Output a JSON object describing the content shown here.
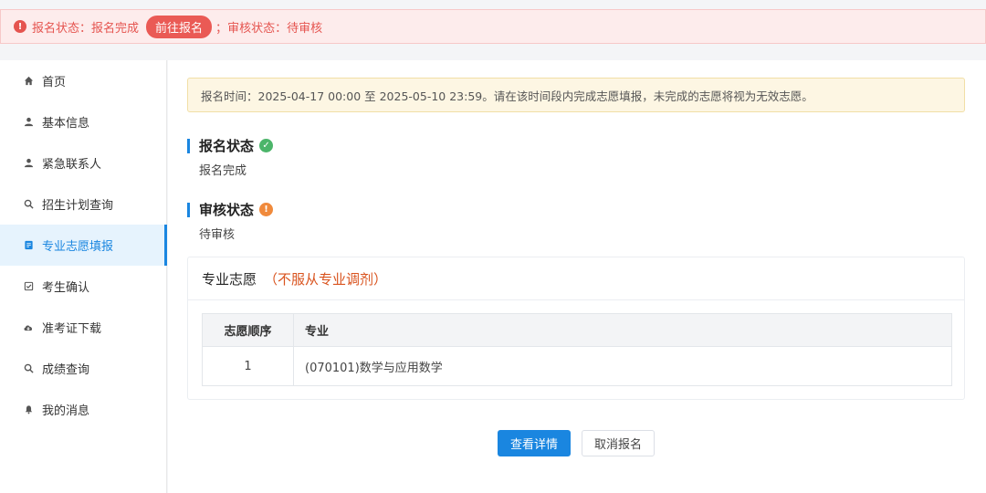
{
  "top_alert": {
    "status_label": "报名状态：",
    "status_value": "报名完成",
    "goto_button": "前往报名",
    "separator": "；",
    "review_label": "审核状态：",
    "review_value": "待审核",
    "icon": "error-icon",
    "color": "#e5544f"
  },
  "sidebar": {
    "active_color": "#1a86e0",
    "items": [
      {
        "label": "首页",
        "icon": "home-icon",
        "active": false
      },
      {
        "label": "基本信息",
        "icon": "user-icon",
        "active": false
      },
      {
        "label": "紧急联系人",
        "icon": "user-icon",
        "active": false
      },
      {
        "label": "招生计划查询",
        "icon": "search-icon",
        "active": false
      },
      {
        "label": "专业志愿填报",
        "icon": "document-icon",
        "active": true
      },
      {
        "label": "考生确认",
        "icon": "checkbox-icon",
        "active": false
      },
      {
        "label": "准考证下载",
        "icon": "cloud-download-icon",
        "active": false
      },
      {
        "label": "成绩查询",
        "icon": "search-icon",
        "active": false
      },
      {
        "label": "我的消息",
        "icon": "bell-icon",
        "active": false
      }
    ]
  },
  "notice": "报名时间：2025-04-17 00:00 至 2025-05-10 23:59。请在该时间段内完成志愿填报，未完成的志愿将视为无效志愿。",
  "registration": {
    "title": "报名状态",
    "value": "报名完成",
    "icon": "check-circle-icon"
  },
  "review": {
    "title": "审核状态",
    "value": "待审核",
    "icon": "warning-circle-icon"
  },
  "preferences": {
    "title": "专业志愿",
    "note": "（不服从专业调剂）",
    "columns": [
      "志愿顺序",
      "专业"
    ],
    "rows": [
      {
        "order": "1",
        "major": "(070101)数学与应用数学"
      }
    ]
  },
  "actions": {
    "details_button": "查看详情",
    "cancel_button": "取消报名"
  }
}
